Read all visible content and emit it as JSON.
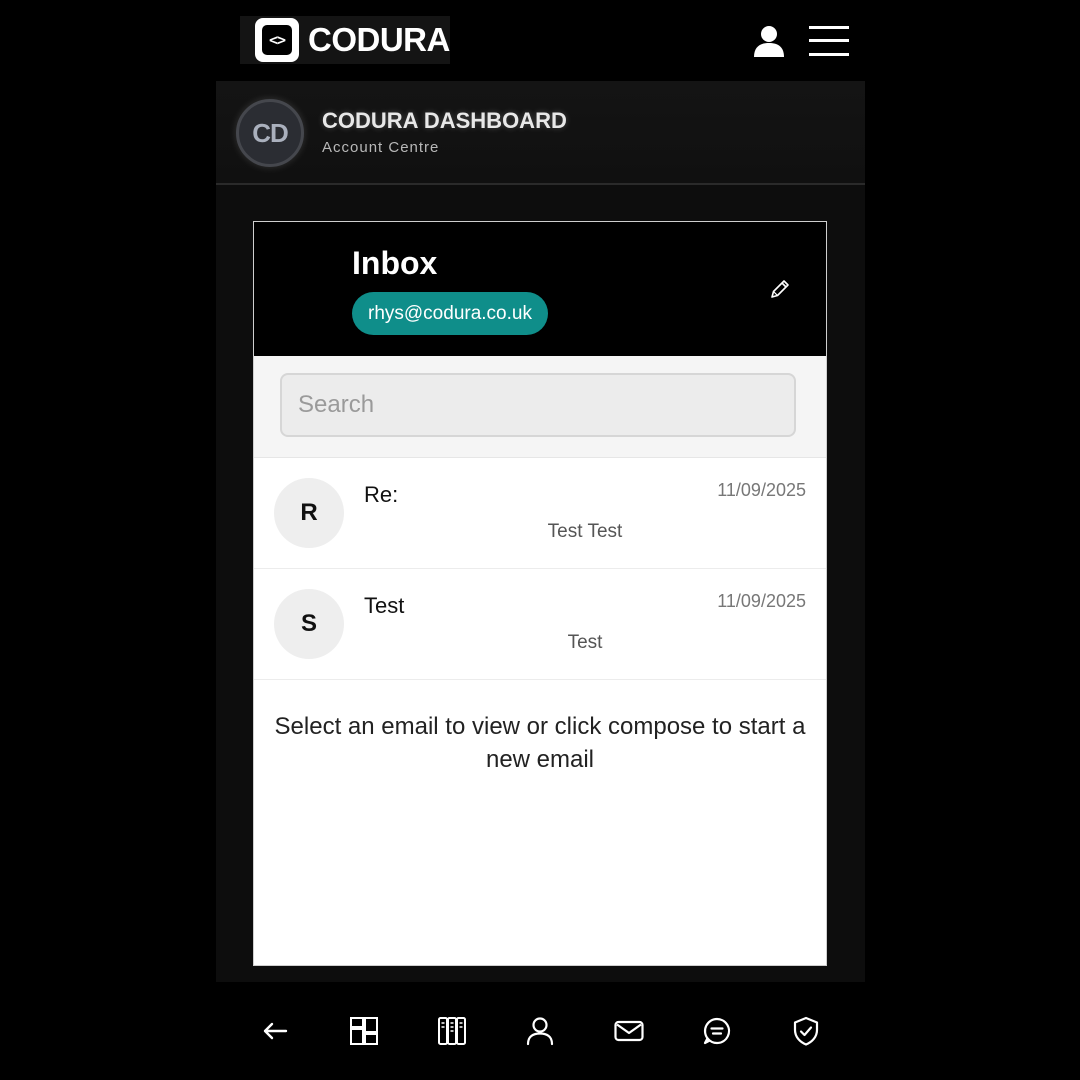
{
  "app": {
    "logo_text": "CODURA",
    "logo_glyph": "<>"
  },
  "subheader": {
    "avatar_initials": "CD",
    "title": "CODURA DASHBOARD",
    "subtitle": "Account Centre"
  },
  "inbox": {
    "title": "Inbox",
    "account_email": "rhys@codura.co.uk",
    "accent_color": "#0f8e8a",
    "search_placeholder": "Search",
    "search_value": "",
    "emails": [
      {
        "initial": "R",
        "subject": "Re:",
        "date": "11/09/2025",
        "preview": "Test Test"
      },
      {
        "initial": "S",
        "subject": "Test",
        "date": "11/09/2025",
        "preview": "Test"
      }
    ],
    "empty_message": "Select an email to view or click compose to start a new email"
  },
  "icons": {
    "top": [
      "user-icon",
      "menu-icon"
    ],
    "compose": "pencil-icon",
    "bottom_nav": [
      "back-arrow-icon",
      "dashboard-grid-icon",
      "columns-icon",
      "user-icon",
      "mail-icon",
      "chat-icon",
      "shield-check-icon"
    ]
  }
}
